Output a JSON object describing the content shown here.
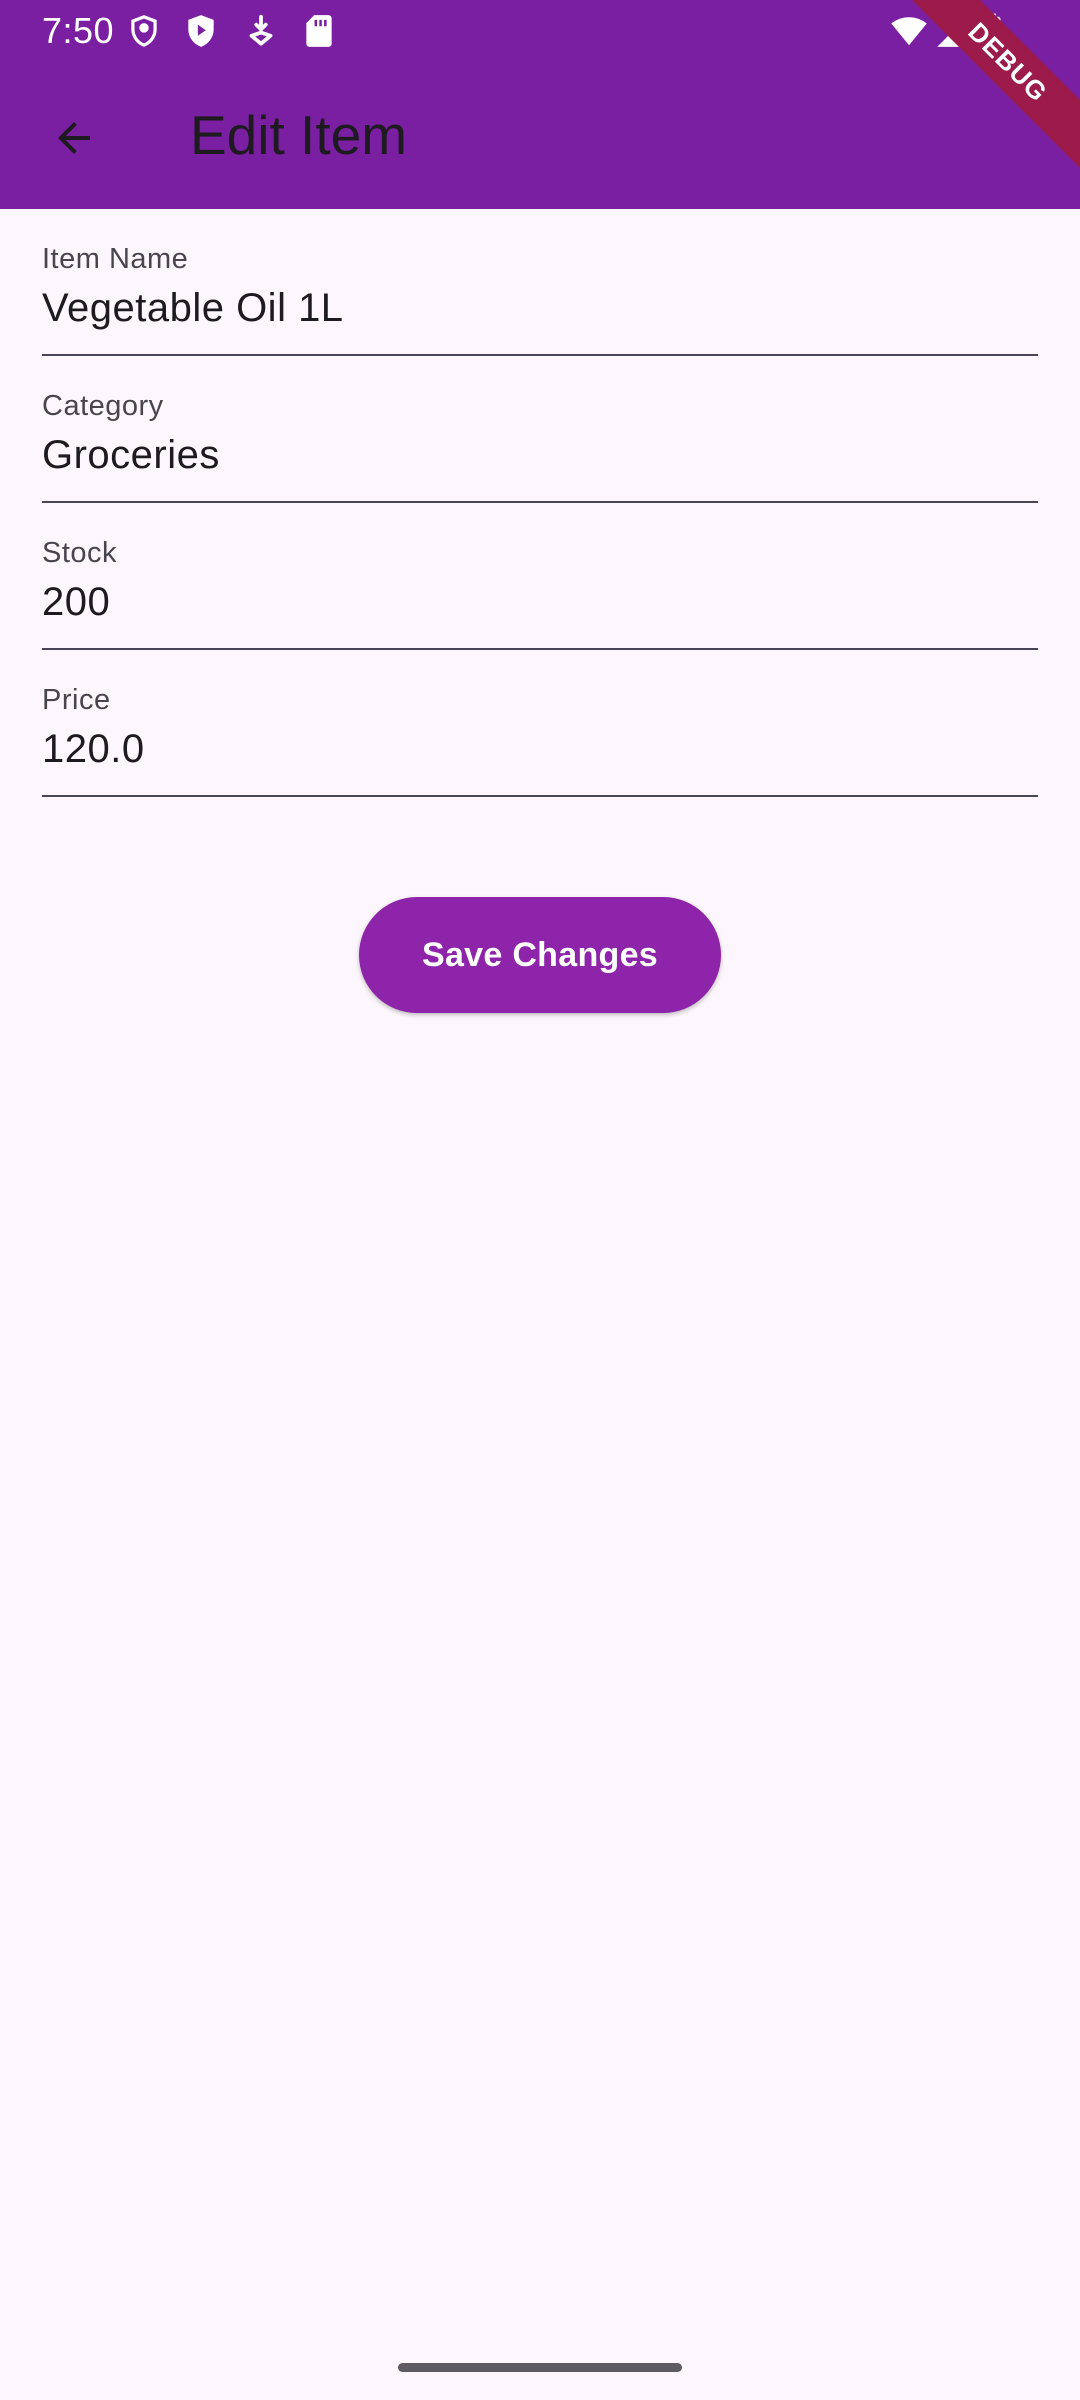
{
  "status_bar": {
    "time": "7:50",
    "left_icons": [
      "shield-outline-icon",
      "shield-play-icon",
      "download-badge-icon",
      "sd-card-icon"
    ],
    "right_icons": [
      "wifi-icon",
      "cellular-signal-icon",
      "battery-icon"
    ]
  },
  "app_bar": {
    "title": "Edit Item",
    "background_color": "#7B1FA2",
    "back_icon": "arrow-back-icon"
  },
  "debug_banner": "DEBUG",
  "form": {
    "fields": [
      {
        "label": "Item Name",
        "value": "Vegetable Oil 1L"
      },
      {
        "label": "Category",
        "value": "Groceries"
      },
      {
        "label": "Stock",
        "value": "200"
      },
      {
        "label": "Price",
        "value": "120.0"
      }
    ],
    "save_label": "Save Changes",
    "accent_color": "#8E24AA"
  }
}
